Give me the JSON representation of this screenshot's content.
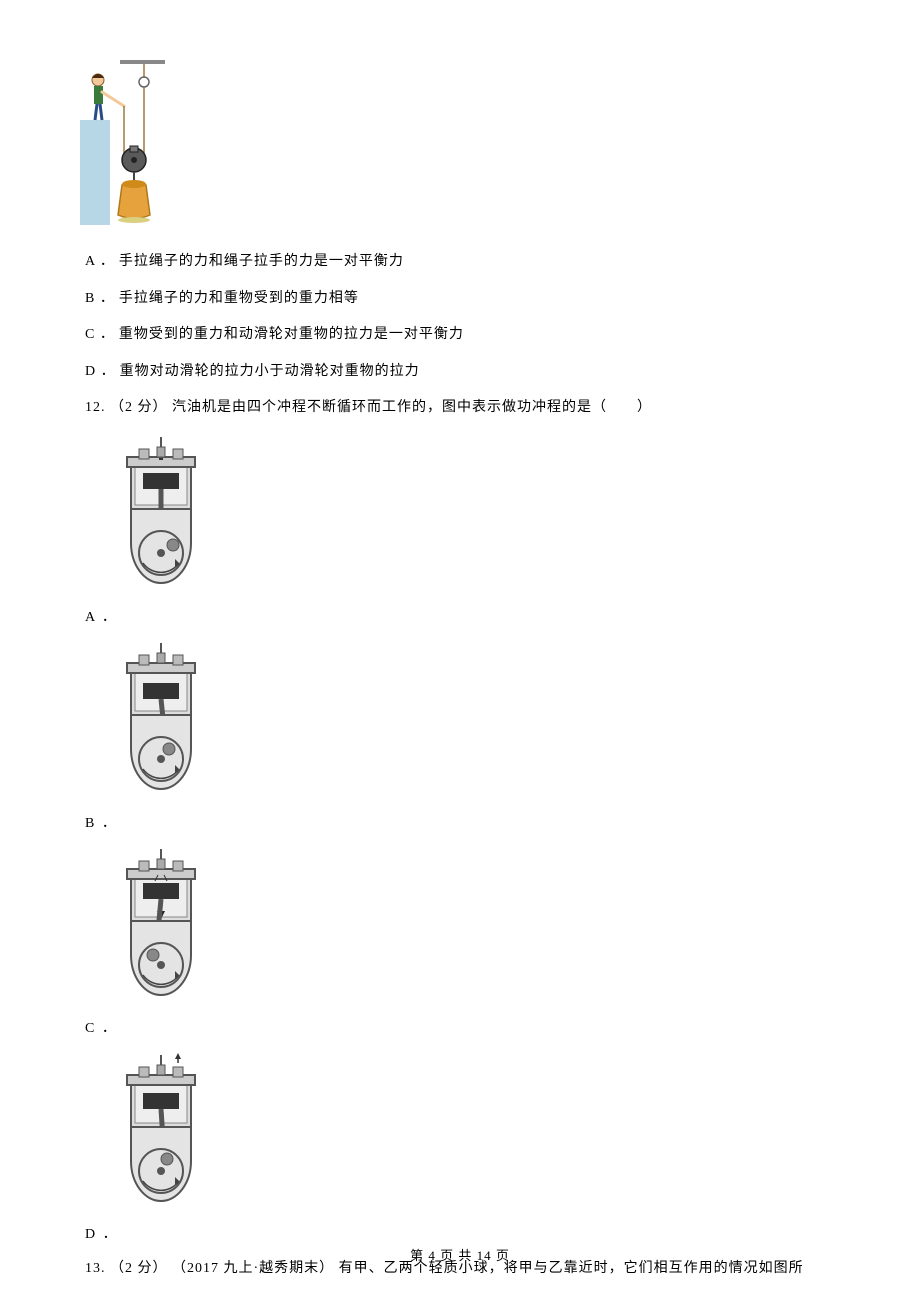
{
  "q11": {
    "options": {
      "A": {
        "label": "A ．",
        "text": "手拉绳子的力和绳子拉手的力是一对平衡力"
      },
      "B": {
        "label": "B ．",
        "text": "手拉绳子的力和重物受到的重力相等"
      },
      "C": {
        "label": "C ．",
        "text": "重物受到的重力和动滑轮对重物的拉力是一对平衡力"
      },
      "D": {
        "label": "D ．",
        "text": "重物对动滑轮的拉力小于动滑轮对重物的拉力"
      }
    }
  },
  "q12": {
    "number": "12.",
    "points": "（2 分）",
    "stem": " 汽油机是由四个冲程不断循环而工作的，图中表示做功冲程的是（　　）",
    "option_labels": {
      "A": "A ．",
      "B": "B ．",
      "C": "C ．",
      "D": "D ．"
    }
  },
  "q13": {
    "number": "13.",
    "points": "（2 分）",
    "meta": "（2017 九上·越秀期末）",
    "stem": "有甲、乙两个轻质小球，将甲与乙靠近时，它们相互作用的情况如图所"
  },
  "footer": "第 4 页 共 14 页"
}
